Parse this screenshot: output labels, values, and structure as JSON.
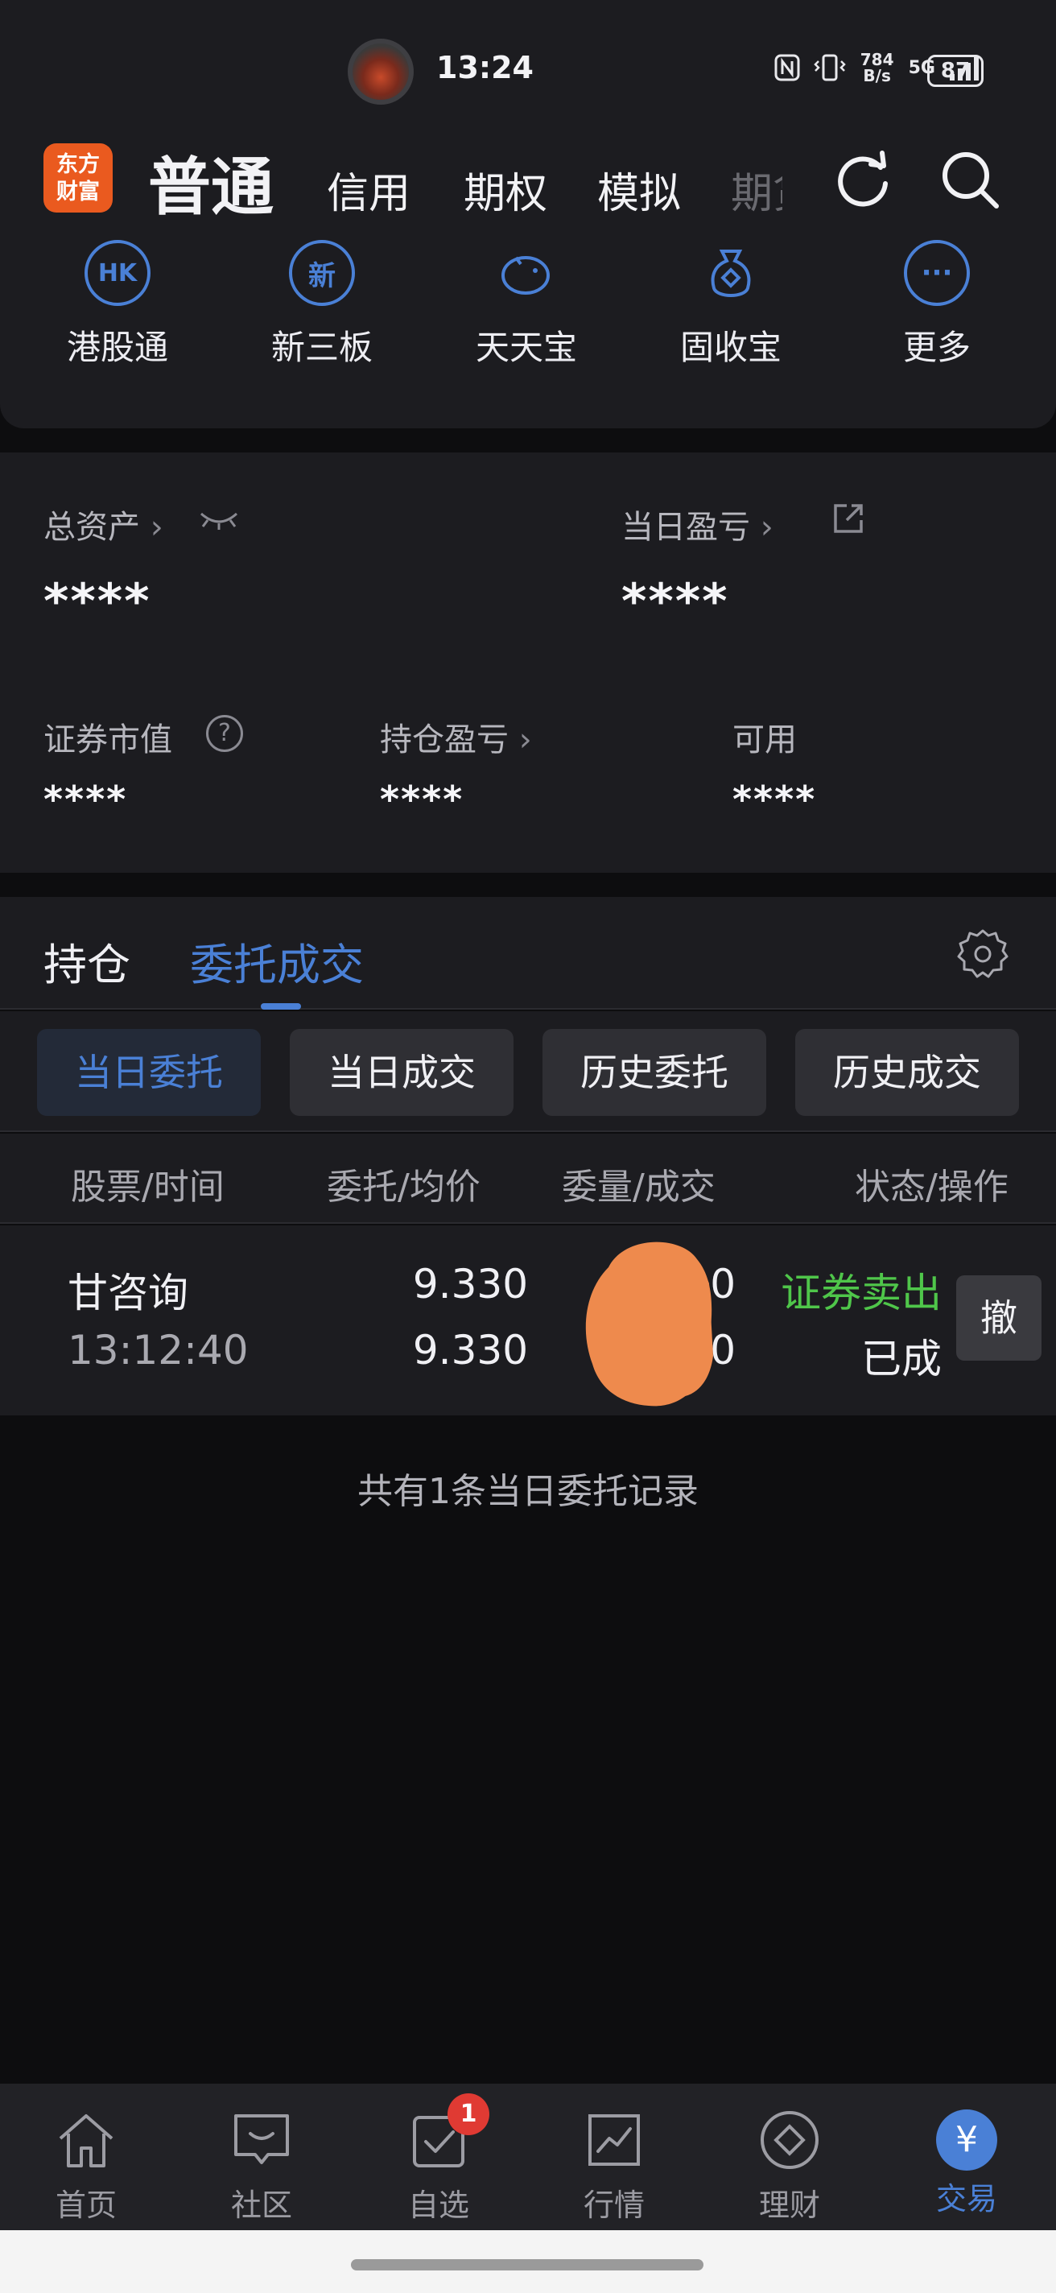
{
  "status_bar": {
    "time": "13:24",
    "net_speed": "784 B/s",
    "network": "5G",
    "battery": "87",
    "icons": [
      "nfc-icon",
      "vibrate-icon",
      "signal-icon",
      "battery-icon"
    ]
  },
  "header": {
    "logo_line1": "东方",
    "logo_line2": "财富",
    "tabs": [
      {
        "label": "普通",
        "active": true
      },
      {
        "label": "信用"
      },
      {
        "label": "期权"
      },
      {
        "label": "模拟"
      },
      {
        "label": "期货"
      }
    ]
  },
  "quick_menu": [
    {
      "label": "港股通",
      "icon_text": "HK",
      "icon": "hk-icon"
    },
    {
      "label": "新三板",
      "icon_text": "新",
      "icon": "new-board-icon"
    },
    {
      "label": "天天宝",
      "icon_text": "",
      "icon": "piggy-bank-icon"
    },
    {
      "label": "固收宝",
      "icon_text": "",
      "icon": "money-bag-icon"
    },
    {
      "label": "更多",
      "icon_text": "···",
      "icon": "more-icon"
    }
  ],
  "assets": {
    "total_label": "总资产",
    "total_value": "****",
    "daily_pl_label": "当日盈亏",
    "daily_pl_value": "****",
    "market_value_label": "证券市值",
    "market_value_value": "****",
    "position_pl_label": "持仓盈亏",
    "position_pl_value": "****",
    "available_label": "可用",
    "available_value": "****"
  },
  "main_tabs": {
    "holdings": "持仓",
    "orders": "委托成交"
  },
  "sub_tabs": [
    "当日委托",
    "当日成交",
    "历史委托",
    "历史成交"
  ],
  "table": {
    "headers": [
      "股票/时间",
      "委托/均价",
      "委量/成交",
      "状态/操作"
    ],
    "rows": [
      {
        "stock": "甘咨询",
        "time": "13:12:40",
        "order_price": "9.330",
        "avg_price": "9.330",
        "qty_tail_1": "0",
        "qty_tail_2": "0",
        "direction": "证券卖出",
        "status": "已成",
        "action": "撤"
      }
    ],
    "summary": "共有1条当日委托记录"
  },
  "bottom_nav": [
    {
      "label": "首页",
      "icon": "home-icon"
    },
    {
      "label": "社区",
      "icon": "community-icon"
    },
    {
      "label": "自选",
      "icon": "watchlist-icon",
      "badge": "1"
    },
    {
      "label": "行情",
      "icon": "market-chart-icon"
    },
    {
      "label": "理财",
      "icon": "wealth-icon"
    },
    {
      "label": "交易",
      "icon": "trade-icon",
      "icon_text": "¥",
      "active": true
    }
  ],
  "colors": {
    "accent": "#4a80d6",
    "sell_green": "#4fc64a",
    "logo_orange": "#ea5a1f",
    "badge_red": "#e03a33"
  }
}
